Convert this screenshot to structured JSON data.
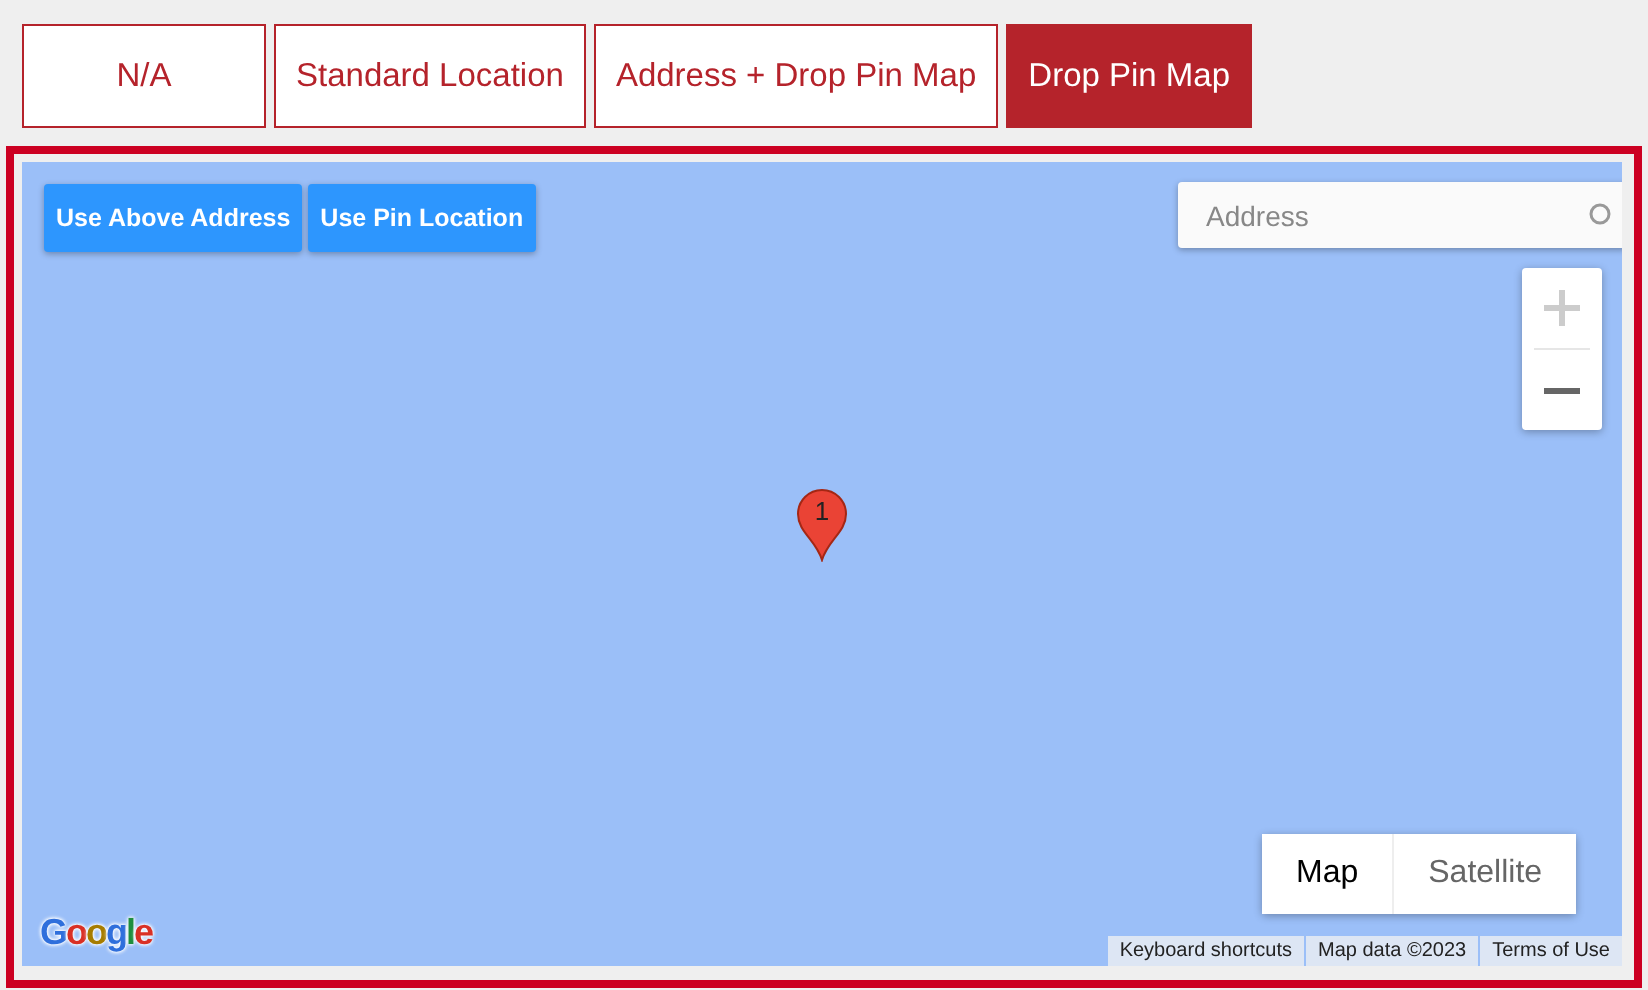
{
  "tabs": [
    {
      "label": "N/A",
      "selected": false
    },
    {
      "label": "Standard Location",
      "selected": false
    },
    {
      "label": "Address + Drop Pin Map",
      "selected": false
    },
    {
      "label": "Drop Pin Map",
      "selected": true
    }
  ],
  "map": {
    "buttons": [
      "Use Above Address",
      "Use Pin Location"
    ],
    "search": {
      "placeholder": "Address"
    },
    "zoom_in": {
      "disabled": true
    },
    "zoom_out": {
      "disabled": false
    },
    "pin": {
      "label": "1"
    },
    "map_types": [
      {
        "label": "Map",
        "selected": true
      },
      {
        "label": "Satellite",
        "selected": false
      }
    ],
    "logo": "Google",
    "footer_links": [
      "Keyboard shortcuts",
      "Map data ©2023",
      "Terms of Use"
    ]
  }
}
